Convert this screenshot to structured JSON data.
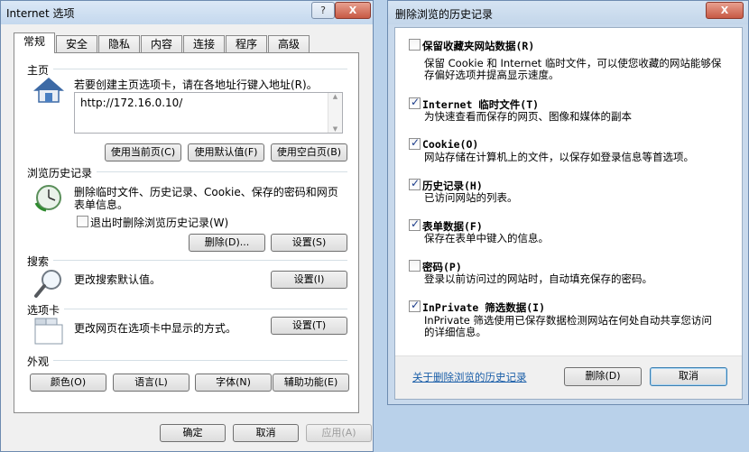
{
  "internet_options": {
    "title": "Internet 选项",
    "help_button": "?",
    "close_button": "X",
    "tabs": [
      "常规",
      "安全",
      "隐私",
      "内容",
      "连接",
      "程序",
      "高级"
    ],
    "homepage": {
      "section": "主页",
      "description": "若要创建主页选项卡，请在各地址行键入地址(R)。",
      "url": "http://172.16.0.10/",
      "use_current": "使用当前页(C)",
      "use_default": "使用默认值(F)",
      "use_blank": "使用空白页(B)"
    },
    "history": {
      "section": "浏览历史记录",
      "description_line1": "删除临时文件、历史记录、Cookie、保存的密码和网页",
      "description_line2": "表单信息。",
      "checkbox_label": "退出时删除浏览历史记录(W)",
      "checkbox_checked": false,
      "delete_button": "删除(D)...",
      "settings_button": "设置(S)"
    },
    "search": {
      "section": "搜索",
      "description": "更改搜索默认值。",
      "settings_button": "设置(I)"
    },
    "tabs_section": {
      "section": "选项卡",
      "description": "更改网页在选项卡中显示的方式。",
      "settings_button": "设置(T)"
    },
    "appearance": {
      "section": "外观",
      "colors": "颜色(O)",
      "languages": "语言(L)",
      "fonts": "字体(N)",
      "accessibility": "辅助功能(E)"
    },
    "ok": "确定",
    "cancel": "取消",
    "apply": "应用(A)"
  },
  "delete_history": {
    "title": "删除浏览的历史记录",
    "close_button": "X",
    "options": [
      {
        "title": "保留收藏夹网站数据(R)",
        "desc1": "保留 Cookie 和 Internet 临时文件，可以使您收藏的网站能够保",
        "desc2": "存偏好选项并提高显示速度。",
        "checked": false
      },
      {
        "title": "Internet 临时文件(T)",
        "desc1": "为快速查看而保存的网页、图像和媒体的副本",
        "desc2": "",
        "checked": true
      },
      {
        "title": "Cookie(O)",
        "desc1": "网站存储在计算机上的文件，以保存如登录信息等首选项。",
        "desc2": "",
        "checked": true
      },
      {
        "title": "历史记录(H)",
        "desc1": "已访问网站的列表。",
        "desc2": "",
        "checked": true
      },
      {
        "title": "表单数据(F)",
        "desc1": "保存在表单中键入的信息。",
        "desc2": "",
        "checked": true
      },
      {
        "title": "密码(P)",
        "desc1": "登录以前访问过的网站时，自动填充保存的密码。",
        "desc2": "",
        "checked": false
      },
      {
        "title": "InPrivate 筛选数据(I)",
        "desc1": "InPrivate 筛选使用已保存数据检测网站在何处自动共享您访问",
        "desc2": "的详细信息。",
        "checked": true
      }
    ],
    "about_link": "关于删除浏览的历史记录",
    "delete_button": "删除(D)",
    "cancel_button": "取消"
  }
}
